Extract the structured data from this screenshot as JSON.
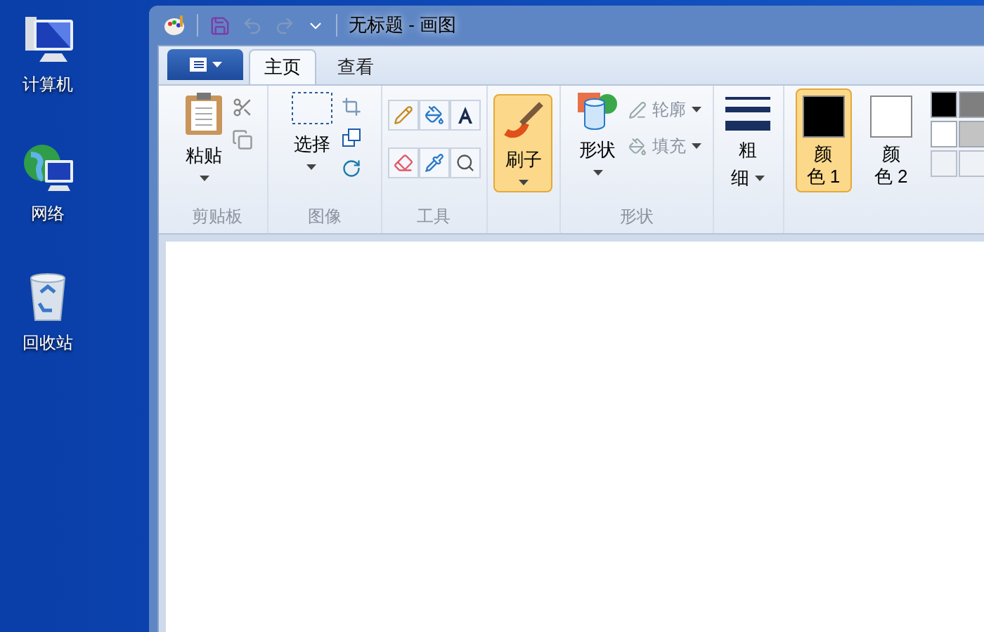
{
  "desktop_icons": [
    {
      "kind": "computer",
      "label": "计算机"
    },
    {
      "kind": "network",
      "label": "网络"
    },
    {
      "kind": "recycle",
      "label": "回收站"
    }
  ],
  "window": {
    "title": "无标题 - 画图"
  },
  "tabs": [
    {
      "label": "主页",
      "selected": true
    },
    {
      "label": "查看",
      "selected": false
    }
  ],
  "ribbon": {
    "clipboard": {
      "paste": "粘贴",
      "group_label": "剪贴板"
    },
    "image": {
      "select": "选择",
      "group_label": "图像"
    },
    "tools": {
      "group_label": "工具"
    },
    "brushes": {
      "label": "刷子",
      "selected": true
    },
    "shapes": {
      "label": "形状",
      "outline": "轮廓",
      "fill": "填充",
      "group_label": "形状"
    },
    "size": {
      "lines": [
        "粗",
        "细"
      ]
    },
    "colors": [
      {
        "lines": [
          "颜",
          "色 1"
        ],
        "selected": true,
        "color": "#000000"
      },
      {
        "lines": [
          "颜",
          "色 2"
        ],
        "selected": false,
        "color": "#ffffff"
      }
    ],
    "palette": [
      {
        "color": "#000000"
      },
      {
        "color": "#7f7f7f"
      },
      {
        "color": "#ffffff"
      },
      {
        "color": "#c3c3c3"
      }
    ]
  }
}
